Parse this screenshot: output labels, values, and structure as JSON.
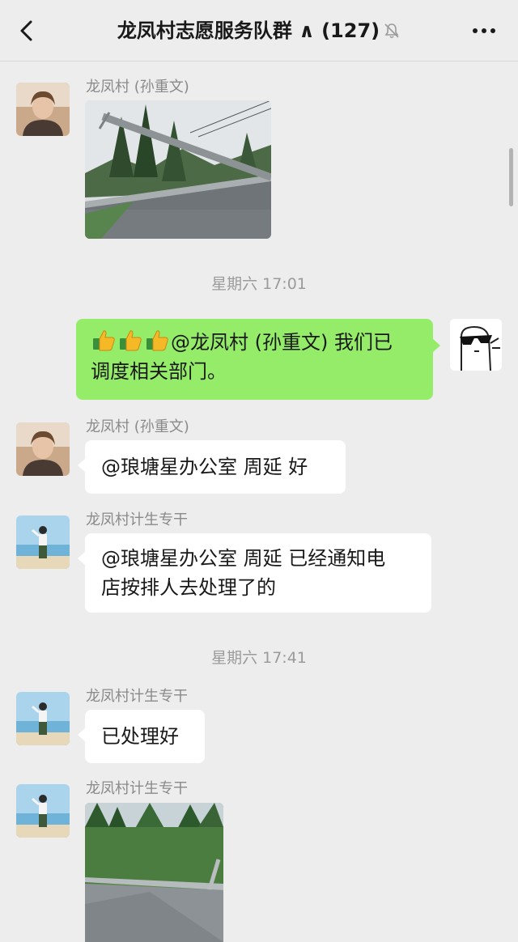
{
  "header": {
    "back_icon": "chevron-left-icon",
    "title": "龙凤村志愿服务队群 ∧ (127)",
    "mute_icon": "bell-muted-icon",
    "more_icon": "more-dots-icon"
  },
  "messages": [
    {
      "sender": "龙凤村 (孙重文)",
      "type": "image",
      "image": "fallen-utility-pole-photo"
    },
    {
      "type": "time",
      "text": "星期六 17:01"
    },
    {
      "self": true,
      "type": "text",
      "emoji": "thumbs-up-icon x3",
      "line1": "@龙凤村 (孙重文)  我们已",
      "line2": "调度相关部门。"
    },
    {
      "sender": "龙凤村 (孙重文)",
      "type": "text",
      "text": "@琅塘星办公室 周延 好"
    },
    {
      "sender": "龙凤村计生专干",
      "type": "text",
      "line1": "@琅塘星办公室 周延 已经通知电",
      "line2": "店按排人去处理了的"
    },
    {
      "type": "time",
      "text": "星期六 17:41"
    },
    {
      "sender": "龙凤村计生专干",
      "type": "text",
      "text": "已处理好"
    },
    {
      "sender": "龙凤村计生专干",
      "type": "image",
      "image": "cleared-road-photo"
    }
  ],
  "colors": {
    "background": "#ededed",
    "self_bubble": "#95ec69",
    "other_bubble": "#ffffff"
  }
}
